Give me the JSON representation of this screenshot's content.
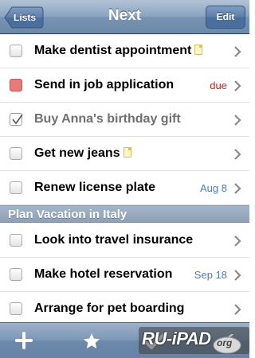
{
  "navbar": {
    "back_label": "Lists",
    "title": "Next",
    "edit_label": "Edit"
  },
  "tasks_top": [
    {
      "title": "Make dentist appointment",
      "status": "open",
      "has_note": true,
      "meta": ""
    },
    {
      "title": "Send in job application",
      "status": "due",
      "has_note": false,
      "meta": "due"
    },
    {
      "title": "Buy Anna's birthday gift",
      "status": "done",
      "has_note": false,
      "meta": ""
    },
    {
      "title": "Get new jeans",
      "status": "open",
      "has_note": true,
      "meta": ""
    },
    {
      "title": "Renew license plate",
      "status": "open",
      "has_note": false,
      "meta": "Aug 8"
    }
  ],
  "section": {
    "title": "Plan Vacation in Italy"
  },
  "tasks_section": [
    {
      "title": "Look into travel insurance",
      "status": "open",
      "has_note": false,
      "meta": ""
    },
    {
      "title": "Make hotel reservation",
      "status": "open",
      "has_note": false,
      "meta": "Sep 18"
    },
    {
      "title": "Arrange for pet boarding",
      "status": "open",
      "has_note": false,
      "meta": ""
    }
  ],
  "toolbar": {
    "icons": [
      "add-icon",
      "star-icon",
      "checkmark-icon"
    ]
  },
  "watermark": {
    "text": "RU-iPAD",
    "suffix": "org"
  },
  "colors": {
    "navbar": "#7893b3",
    "due_checkbox": "#e77b7b",
    "due_text": "#cc1f1f",
    "date_text": "#4a7bbd"
  }
}
